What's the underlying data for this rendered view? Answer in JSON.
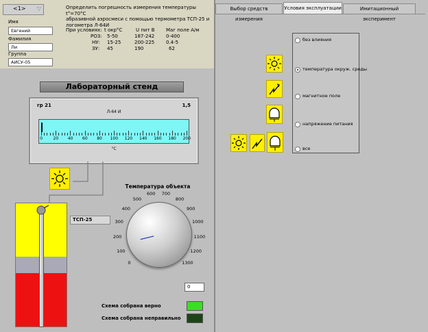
{
  "nav": {
    "value": "<1>"
  },
  "student": {
    "first_name_label": "Имя",
    "first_name": "Евгений",
    "last_name_label": "Фамилия",
    "last_name": "Ли",
    "group_label": "Группа",
    "group": "АИСУ-05"
  },
  "task": {
    "line1": "Определить погрешность измерения температуры t°=70°C",
    "line2": "абразивной аэросмеси с помощью термометра ТСП-25 и",
    "line3": "логометра Л-64И",
    "cond_header": "При условиях:",
    "col1": "t окр°C",
    "col2": "U пит В",
    "col3": "Маг поле А/м",
    "rows": [
      {
        "name": "РОЗ:",
        "t": "5-50",
        "u": "187-242",
        "m": "0-400"
      },
      {
        "name": "НУ:",
        "t": "15-25",
        "u": "200-225",
        "m": "0.4-5"
      },
      {
        "name": "ЗУ:",
        "t": "45",
        "u": "190",
        "m": "62"
      }
    ]
  },
  "stand": {
    "title": "Лабораторный стенд",
    "gauge": {
      "group": "гр 21",
      "class": "1,5",
      "model": "Л-64 И",
      "unit": "°C",
      "ticks": [
        "0",
        "20",
        "40",
        "60",
        "80",
        "100",
        "120",
        "140",
        "160",
        "180",
        "200"
      ],
      "value": 0
    },
    "sensor_label": "ТСП-25",
    "dial": {
      "title": "Температура объекта",
      "labels": [
        "0",
        "100",
        "200",
        "300",
        "400",
        "500",
        "600",
        "700",
        "800",
        "900",
        "1000",
        "1100",
        "1200",
        "1300"
      ],
      "value": 150,
      "max": 1300
    },
    "numeric_value": "0",
    "status_ok": "Схема собрана верно",
    "status_bad": "Схема собрана неправильно"
  },
  "tabs": [
    {
      "label": "Выбор средств измерения",
      "active": false
    },
    {
      "label": "Условия эксплуатации",
      "active": true
    },
    {
      "label": "Имитационный эксперимент",
      "active": false
    }
  ],
  "conditions": {
    "options": [
      {
        "label": "без влияния",
        "selected": false
      },
      {
        "label": "температура окруж. среды",
        "selected": true
      },
      {
        "label": "магнитное поле",
        "selected": false
      },
      {
        "label": "напряжение питания",
        "selected": false
      },
      {
        "label": "все",
        "selected": false
      }
    ]
  },
  "colors": {
    "gauge_band": "#7ff6f6",
    "ok_led": "#39e022",
    "bad_led": "#1d4419",
    "icon_yellow": "#ffef00"
  }
}
